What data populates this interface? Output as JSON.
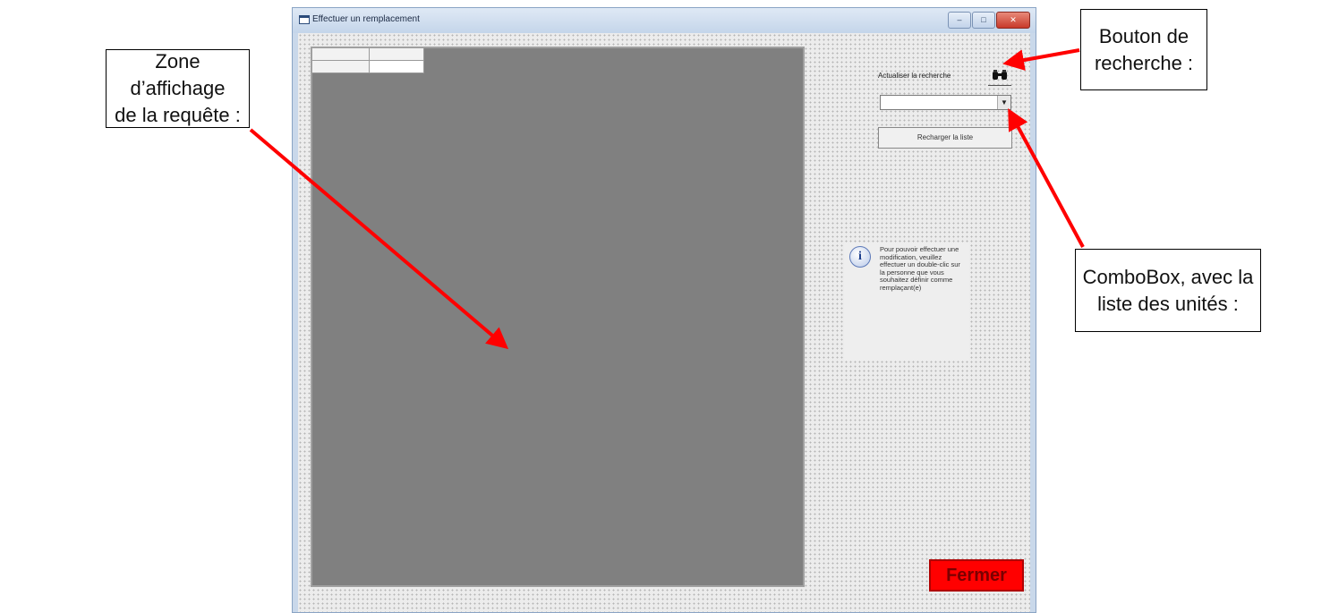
{
  "window": {
    "title": "Effectuer un remplacement",
    "controls": [
      "–",
      "□",
      "✕"
    ]
  },
  "search": {
    "label": "Actualiser la recherche",
    "button_icon": "binoculars-icon"
  },
  "combo": {
    "selected_value": "",
    "arrow": "▼"
  },
  "reload_button": {
    "label": "Recharger la liste"
  },
  "info": {
    "icon": "i",
    "text": "Pour pouvoir effectuer une modification, veuillez effectuer un double-clic sur la personne que vous souhaitez définir comme remplaçant(e)"
  },
  "close_button": {
    "label": "Fermer"
  },
  "annotations": {
    "zone": "Zone d’affichage\nde la requête :",
    "search_button": "Bouton de\nrecherche :",
    "combobox": "ComboBox, avec la\nliste des unités :"
  },
  "colors": {
    "arrow": "#ff0000",
    "close_button": "#ff0000",
    "grid_background": "#808080"
  }
}
